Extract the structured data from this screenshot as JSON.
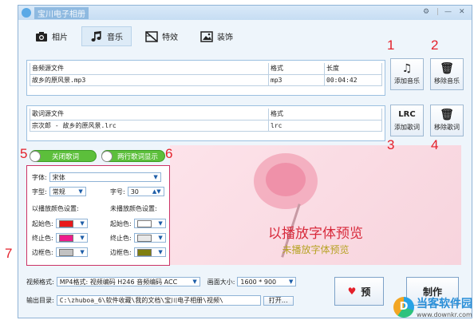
{
  "window": {
    "title": "宝川电子相册"
  },
  "tabs": [
    {
      "label": "相片",
      "icon": "camera-icon"
    },
    {
      "label": "音乐",
      "icon": "music-note-icon"
    },
    {
      "label": "特效",
      "icon": "clapperboard-icon"
    },
    {
      "label": "装饰",
      "icon": "picture-icon"
    }
  ],
  "audio": {
    "headers": [
      "音频源文件",
      "格式",
      "长度"
    ],
    "rows": [
      [
        "故乡的原风景.mp3",
        "mp3",
        "00:04:42"
      ]
    ]
  },
  "lyrics": {
    "headers": [
      "歌词源文件",
      "格式"
    ],
    "rows": [
      [
        "宗次郎 - 故乡的原风景.lrc",
        "lrc"
      ]
    ]
  },
  "buttons": {
    "add_music": "添加音乐",
    "remove_music": "移除音乐",
    "add_lyrics": "添加歌词",
    "remove_lyrics": "移除歌词",
    "lrc_glyph": "LRC"
  },
  "annotations": {
    "n1": "1",
    "n2": "2",
    "n3": "3",
    "n4": "4",
    "n5": "5",
    "n6": "6",
    "n7": "7"
  },
  "toggles": {
    "close_lyrics": "关闭歌词",
    "two_line": "两行歌词显示"
  },
  "settings": {
    "font_label": "字体:",
    "font_value": "宋体",
    "style_label": "字型:",
    "style_value": "常规",
    "size_label": "字号:",
    "size_value": "30",
    "played_title": "以播放颜色设置:",
    "unplayed_title": "未播放颜色设置:",
    "start_label": "起始色:",
    "end_label": "终止色:",
    "border_label": "边框色:",
    "colors": {
      "played_start": "#e8191b",
      "played_end": "#ee1c8c",
      "played_border": "#c2c2c2",
      "unplayed_start": "#ffffff",
      "unplayed_end": "#e8e8e8",
      "unplayed_border": "#7f7f10"
    }
  },
  "preview": {
    "played_text": "以播放字体预览",
    "unplayed_text": "未播放字体预览"
  },
  "bottom": {
    "video_label": "视频格式:",
    "video_value": "MP4格式: 视频编码 H246 音频编码 ACC",
    "size_label": "画面大小:",
    "size_value": "1600 * 900",
    "out_label": "输出目录:",
    "out_value": "C:\\zhuboa_6\\软件收藏\\我的文档\\宝川电子相册\\视频\\",
    "open_button": "打开…",
    "preview_button": "预",
    "make_button": "制作"
  },
  "watermark": {
    "name": "当客软件园",
    "url": "www.downkr.com"
  }
}
